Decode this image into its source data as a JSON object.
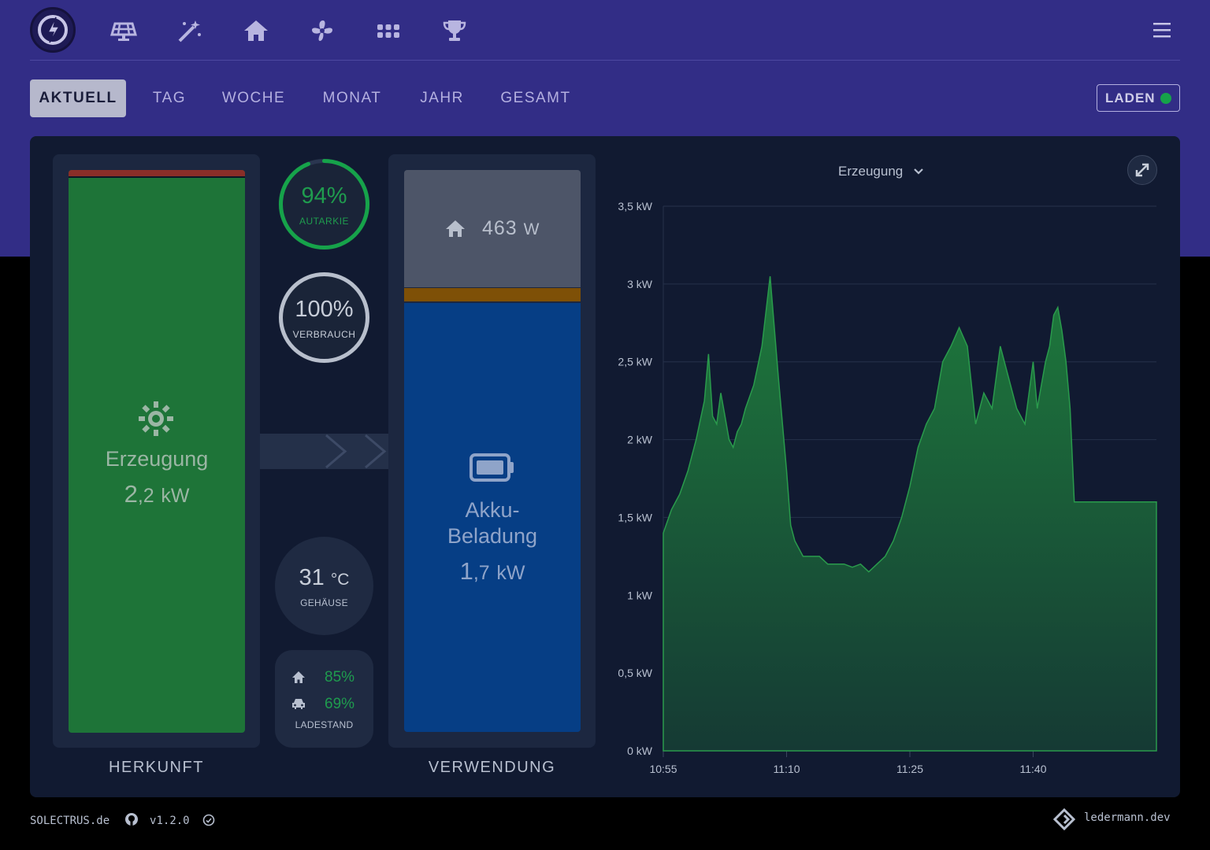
{
  "nav": {
    "icons": [
      "solar-panel-icon",
      "magic-wand-icon",
      "home-icon",
      "fan-icon",
      "grid-icon",
      "trophy-icon"
    ]
  },
  "tabs": [
    {
      "label": "AKTUELL",
      "active": true
    },
    {
      "label": "TAG",
      "active": false
    },
    {
      "label": "WOCHE",
      "active": false
    },
    {
      "label": "MONAT",
      "active": false
    },
    {
      "label": "JAHR",
      "active": false
    },
    {
      "label": "GESAMT",
      "active": false
    }
  ],
  "load_button": {
    "label": "LADEN",
    "status_color": "#16a34a"
  },
  "source": {
    "title": "Erzeugung",
    "value_int": "2",
    "value_dec": ",2",
    "unit": "kW",
    "caption": "HERKUNFT"
  },
  "autarky": {
    "value": "94%",
    "label": "AUTARKIE",
    "fraction": 0.94
  },
  "consumption": {
    "value": "100%",
    "label": "VERBRAUCH",
    "fraction": 1.0
  },
  "temperature": {
    "value": "31",
    "unit": "°C",
    "label": "GEHÄUSE"
  },
  "charge": {
    "home_pct": "85%",
    "car_pct": "69%",
    "label": "LADESTAND"
  },
  "usage": {
    "home_value": "463",
    "home_unit": "W",
    "battery_title_1": "Akku-",
    "battery_title_2": "Beladung",
    "value_int": "1",
    "value_dec": ",7",
    "unit": "kW",
    "caption": "VERWENDUNG"
  },
  "chart_selector": {
    "label": "Erzeugung"
  },
  "chart_data": {
    "type": "area",
    "title": "",
    "xlabel": "",
    "ylabel": "",
    "y_unit": "kW",
    "ylim": [
      0,
      3.5
    ],
    "yticks": [
      "0 kW",
      "0,5 kW",
      "1 kW",
      "1,5 kW",
      "2 kW",
      "2,5 kW",
      "3 kW",
      "3,5 kW"
    ],
    "xticks": [
      "10:55",
      "11:10",
      "11:25",
      "11:40"
    ],
    "x_minutes_range": [
      "10:55",
      "11:55"
    ],
    "series": [
      {
        "color": "#1e7a3c",
        "x": [
          "10:55",
          "10:56",
          "10:57",
          "10:58",
          "10:59",
          "11:00",
          "11:00:30",
          "11:01",
          "11:01:30",
          "11:02",
          "11:02:30",
          "11:03",
          "11:03:30",
          "11:04",
          "11:04:30",
          "11:05",
          "11:06",
          "11:07",
          "11:08",
          "11:09",
          "11:10",
          "11:10:30",
          "11:11",
          "11:12",
          "11:13",
          "11:14",
          "11:15",
          "11:16",
          "11:17",
          "11:18",
          "11:19",
          "11:20",
          "11:21",
          "11:22",
          "11:23",
          "11:24",
          "11:25",
          "11:26",
          "11:27",
          "11:28",
          "11:29",
          "11:30",
          "11:31",
          "11:32",
          "11:33",
          "11:34",
          "11:35",
          "11:36",
          "11:37",
          "11:38",
          "11:39",
          "11:40",
          "11:40:30",
          "11:41",
          "11:41:30",
          "11:42",
          "11:42:30",
          "11:43",
          "11:43:30",
          "11:44",
          "11:44:30",
          "11:45",
          "11:45:30",
          "11:46",
          "11:47",
          "11:48",
          "11:49",
          "11:50",
          "11:51",
          "11:52",
          "11:53",
          "11:54",
          "11:55"
        ],
        "values": [
          1.4,
          1.55,
          1.65,
          1.8,
          2.0,
          2.25,
          2.55,
          2.15,
          2.1,
          2.3,
          2.15,
          2.0,
          1.95,
          2.05,
          2.1,
          2.2,
          2.35,
          2.6,
          3.05,
          2.4,
          1.8,
          1.45,
          1.35,
          1.25,
          1.25,
          1.25,
          1.2,
          1.2,
          1.2,
          1.18,
          1.2,
          1.15,
          1.2,
          1.25,
          1.35,
          1.5,
          1.7,
          1.95,
          2.1,
          2.2,
          2.5,
          2.6,
          2.72,
          2.6,
          2.1,
          2.3,
          2.2,
          2.6,
          2.4,
          2.2,
          2.1,
          2.5,
          2.2,
          2.35,
          2.5,
          2.6,
          2.8,
          2.85,
          2.7,
          2.5,
          2.2,
          1.6,
          1.6,
          1.6,
          1.6,
          1.6,
          1.6,
          1.6,
          1.6,
          1.6,
          1.6,
          1.6,
          1.6
        ]
      }
    ],
    "grid": true,
    "legend": "none"
  },
  "footer": {
    "left_text": "SOLECTRUS.de",
    "version": "v1.2.0",
    "right_text": "ledermann.dev"
  }
}
